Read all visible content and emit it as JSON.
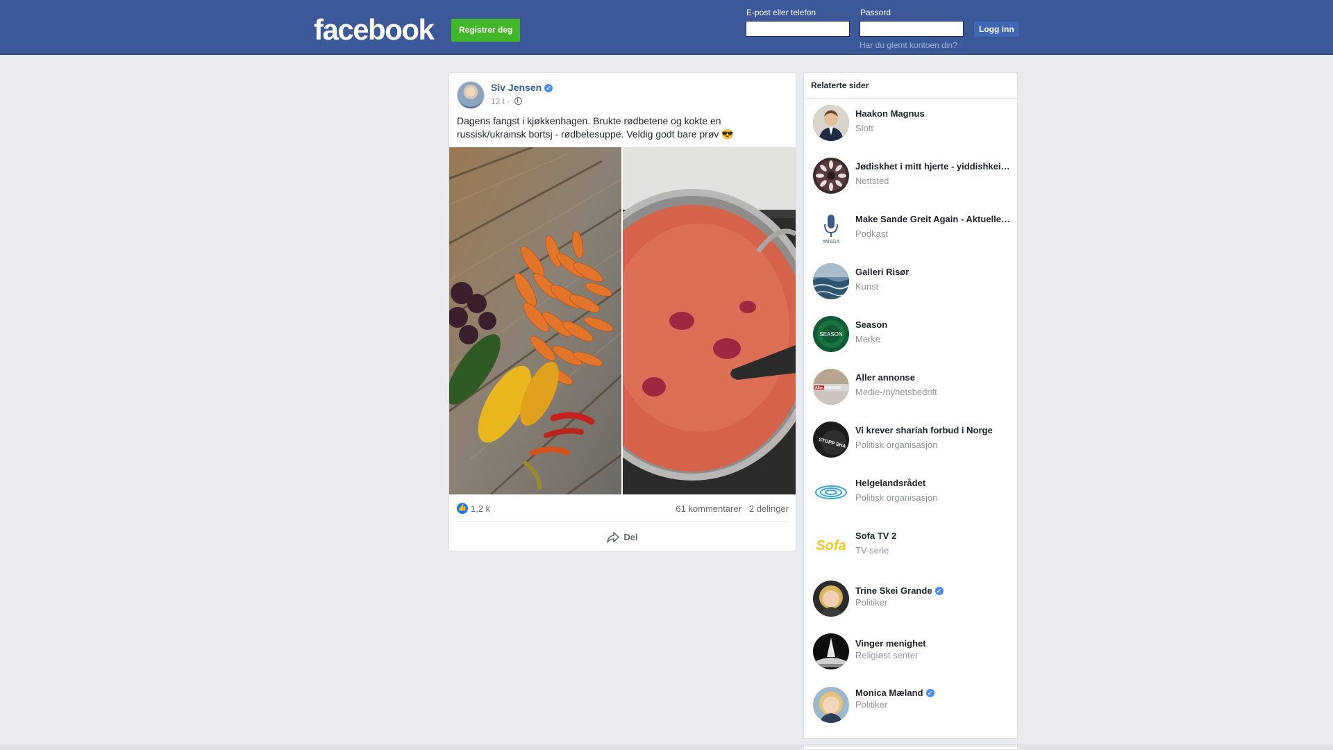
{
  "header": {
    "logo": "facebook",
    "register_label": "Registrer deg",
    "email_label": "E-post eller telefon",
    "password_label": "Passord",
    "login_label": "Logg inn",
    "forgot_label": "Har du glemt kontoen din?",
    "brand_color": "#3b5998",
    "register_color": "#42b72a"
  },
  "post": {
    "author": "Siv Jensen",
    "verified": true,
    "time": "12 t ·",
    "privacy_icon": "globe-icon",
    "text_line1": "Dagens fangst i kjøkkenhagen. Brukte rødbetene og kokte en",
    "text_line2": "russisk/ukrainsk bortsj - rødbetesuppe. Veldig godt bare prøv",
    "emoji": "😎",
    "likes": "1,2 k",
    "comments": "61 kommentarer",
    "shares": "2 delinger",
    "share_label": "Del"
  },
  "related": {
    "title": "Relaterte sider",
    "items": [
      {
        "name": "Haakon Magnus",
        "category": "Slott",
        "verified": false
      },
      {
        "name": "Jødiskhet i mitt hjerte - yiddishkeit in my heart",
        "category": "Nettsted",
        "verified": false
      },
      {
        "name": "Make Sande Greit Again - Aktuelle saker",
        "category": "Podkast",
        "verified": false
      },
      {
        "name": "Galleri Risør",
        "category": "Kunst",
        "verified": false
      },
      {
        "name": "Season",
        "category": "Merke",
        "verified": false
      },
      {
        "name": "Aller annonse",
        "category": "Medie-/nyhetsbedrift",
        "verified": false
      },
      {
        "name": "Vi krever shariah forbud i Norge",
        "category": "Politisk organisasjon",
        "verified": false
      },
      {
        "name": "Helgelandsrådet",
        "category": "Politisk organisasjon",
        "verified": false
      },
      {
        "name": "Sofa TV 2",
        "category": "TV-serie",
        "verified": false
      },
      {
        "name": "Trine Skei Grande",
        "category": "Politiker",
        "verified": true
      },
      {
        "name": "Vinger menighet",
        "category": "Religiøst senter",
        "verified": false
      },
      {
        "name": "Monica Mæland",
        "category": "Politiker",
        "verified": true
      }
    ],
    "avatar_texts": {
      "msga": "#MSGA",
      "season": "SEASON",
      "aller": "Aller ANNONSE",
      "stopp": "STOPP SHA",
      "sofa": "Sofa"
    }
  }
}
